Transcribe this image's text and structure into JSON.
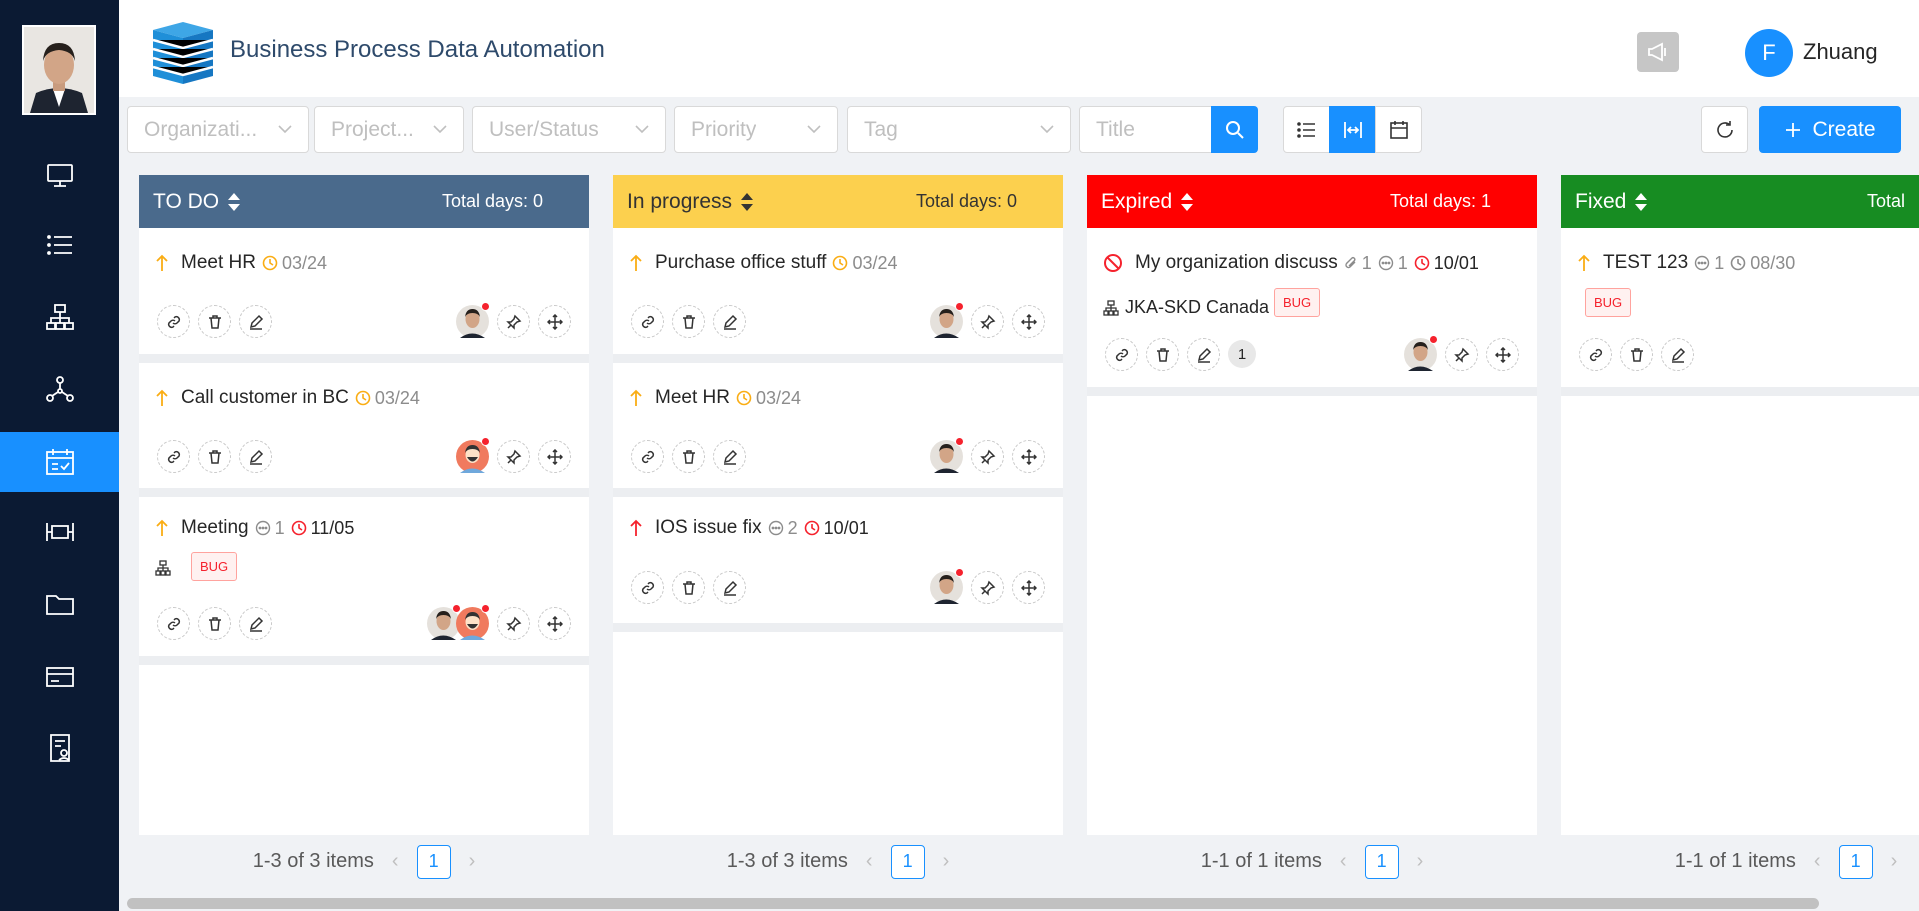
{
  "app": {
    "title": "Business Process Data Automation",
    "user_initial": "F",
    "user_name": "Zhuang"
  },
  "sidebar": {
    "items": [
      {
        "icon": "monitor-icon"
      },
      {
        "icon": "list-icon"
      },
      {
        "icon": "org-chart-icon"
      },
      {
        "icon": "network-icon"
      },
      {
        "icon": "calendar-check-icon",
        "active": true
      },
      {
        "icon": "kanban-icon"
      },
      {
        "icon": "folder-icon"
      },
      {
        "icon": "card-icon"
      },
      {
        "icon": "report-icon"
      }
    ]
  },
  "filters": {
    "organization": "Organizati...",
    "project": "Project...",
    "user_status": "User/Status",
    "priority": "Priority",
    "tag": "Tag",
    "title_placeholder": "Title"
  },
  "toolbar": {
    "create_label": "Create"
  },
  "colors": {
    "todo": "#4a6a8c",
    "in_progress": "#fcd04e",
    "expired": "#ff0000",
    "fixed": "#178c22",
    "accent": "#1890ff",
    "priority_up": "#faad14",
    "priority_high": "#f5222d"
  },
  "columns": [
    {
      "name": "TO DO",
      "total": "Total days: 0",
      "pagination": "1-3 of 3 items",
      "page": "1",
      "cards": [
        {
          "title": "Meet HR",
          "date": "03/24"
        },
        {
          "title": "Call customer in BC",
          "date": "03/24"
        },
        {
          "title": "Meeting",
          "comments": "1",
          "date": "11/05",
          "tag": "BUG"
        }
      ]
    },
    {
      "name": "In progress",
      "total": "Total days: 0",
      "pagination": "1-3 of 3 items",
      "page": "1",
      "cards": [
        {
          "title": "Purchase office stuff",
          "date": "03/24"
        },
        {
          "title": "Meet HR",
          "date": "03/24"
        },
        {
          "title": "IOS issue fix",
          "comments": "2",
          "date": "10/01"
        }
      ]
    },
    {
      "name": "Expired",
      "total": "Total days: 1",
      "pagination": "1-1 of 1 items",
      "page": "1",
      "cards": [
        {
          "title": "My organization discuss",
          "attachments": "1",
          "comments": "1",
          "date": "10/01",
          "org": "JKA-SKD Canada",
          "tag": "BUG",
          "count": "1"
        }
      ]
    },
    {
      "name": "Fixed",
      "total": "Total",
      "pagination": "1-1 of 1 items",
      "page": "1",
      "cards": [
        {
          "title": "TEST 123",
          "comments": "1",
          "date": "08/30",
          "tag": "BUG"
        }
      ]
    }
  ]
}
